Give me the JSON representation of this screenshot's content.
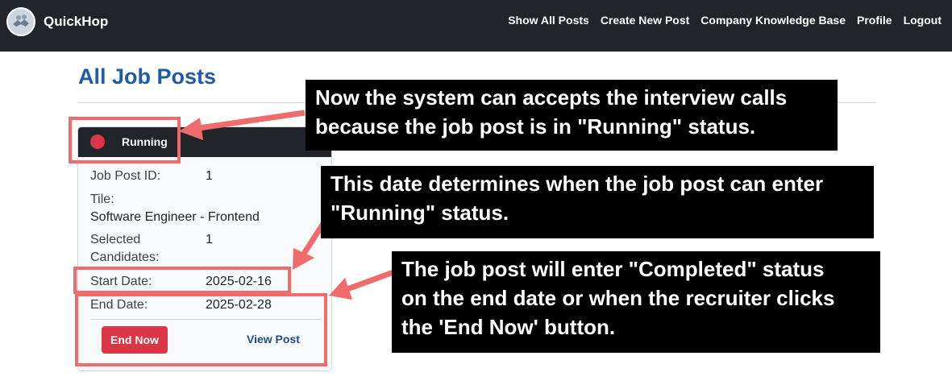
{
  "navbar": {
    "brand": "QuickHop",
    "links": [
      "Show All Posts",
      "Create New Post",
      "Company Knowledge Base",
      "Profile",
      "Logout"
    ]
  },
  "page": {
    "title": "All Job Posts"
  },
  "card": {
    "status": "Running",
    "status_color": "#dc3545",
    "job_post_id_label": "Job Post ID:",
    "job_post_id": "1",
    "title_label": "Tile:",
    "title_value": "Software Engineer - Frontend",
    "selected_label_1": "Selected",
    "selected_label_2": "Candidates:",
    "selected_value": "1",
    "start_label": "Start Date:",
    "start_value": "2025-02-16",
    "end_label": "End Date:",
    "end_value": "2025-02-28",
    "end_now_button": "End Now",
    "view_post_link": "View Post"
  },
  "annotations": {
    "callout_1_line_1": "Now the system can accepts the interview calls",
    "callout_1_line_2": "because the job post is in \"Running\" status.",
    "callout_2_line_1": "This date determines when the job post can enter",
    "callout_2_line_2": "\"Running\" status.",
    "callout_3_line_1": "The job post will enter \"Completed\" status",
    "callout_3_line_2": "on the end date or when the recruiter clicks",
    "callout_3_line_3": "the 'End Now' button.",
    "highlight_color": "#f06b6b"
  }
}
